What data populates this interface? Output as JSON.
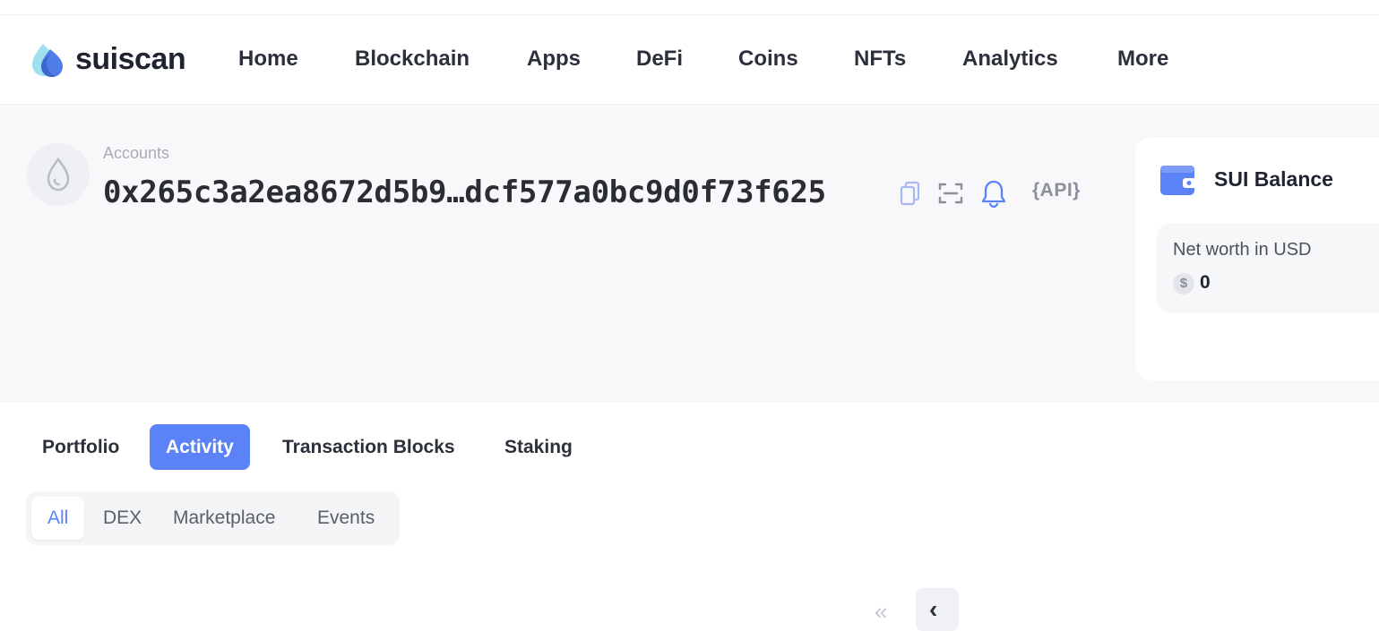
{
  "header": {
    "brand": "suiscan",
    "nav": [
      {
        "label": "Home"
      },
      {
        "label": "Blockchain"
      },
      {
        "label": "Apps"
      },
      {
        "label": "DeFi"
      },
      {
        "label": "Coins"
      },
      {
        "label": "NFTs"
      },
      {
        "label": "Analytics"
      },
      {
        "label": "More"
      }
    ]
  },
  "account": {
    "breadcrumb": "Accounts",
    "address": "0x265c3a2ea8672d5b9…dcf577a0bc9d0f73f625",
    "api_label": "{API}",
    "icons": [
      "copy-icon",
      "qr-scan-icon",
      "bell-icon"
    ]
  },
  "balance_card": {
    "title": "SUI Balance",
    "networth_label": "Net worth in USD",
    "currency_symbol": "$",
    "networth_value": "0"
  },
  "tabs": [
    {
      "label": "Portfolio",
      "active": false
    },
    {
      "label": "Activity",
      "active": true
    },
    {
      "label": "Transaction Blocks",
      "active": false
    },
    {
      "label": "Staking",
      "active": false
    }
  ],
  "subtabs": [
    {
      "label": "All",
      "active": true
    },
    {
      "label": "DEX",
      "active": false
    },
    {
      "label": "Marketplace",
      "active": false
    },
    {
      "label": "Events",
      "active": false
    }
  ],
  "pagination": {
    "first_glyph": "«",
    "prev_glyph": "‹"
  },
  "colors": {
    "accent": "#5b82f6",
    "page_band": "#f8f8fa",
    "text": "#1f2430"
  }
}
